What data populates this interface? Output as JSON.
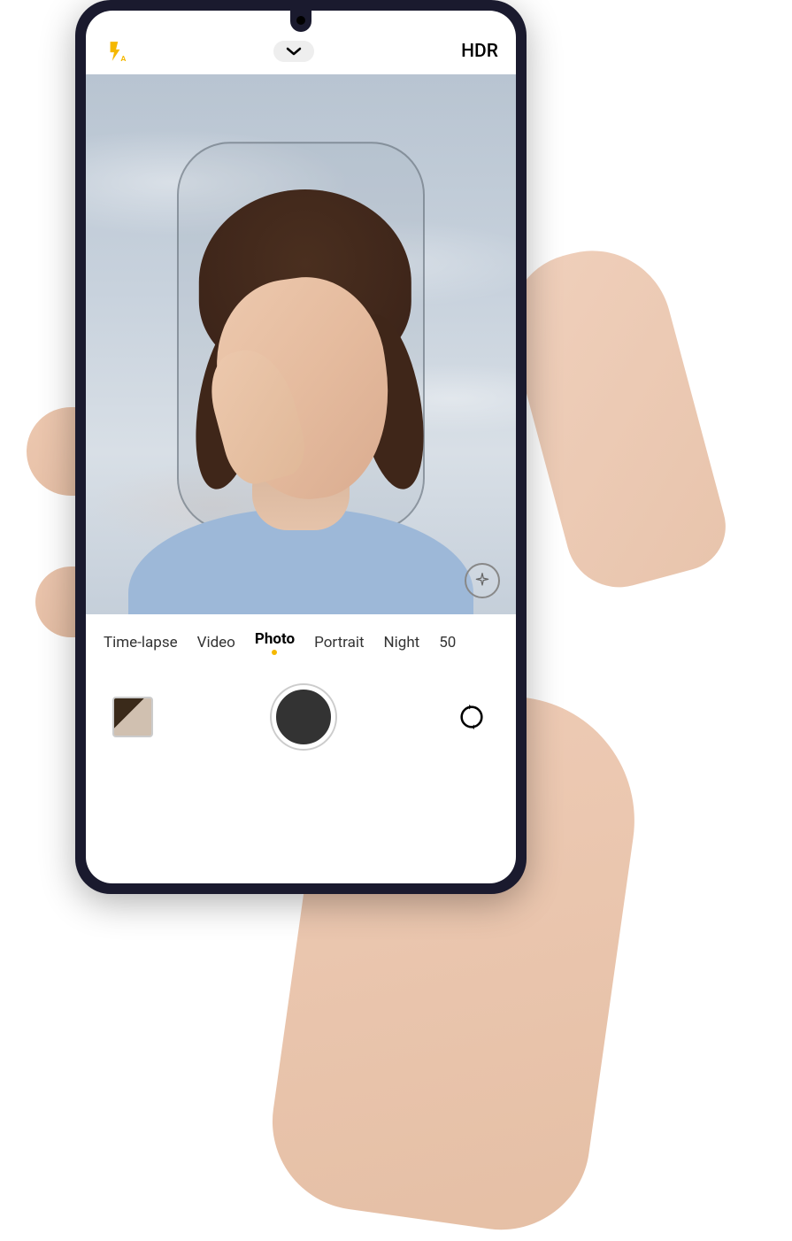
{
  "topbar": {
    "hdr_label": "HDR"
  },
  "modes": {
    "items": [
      "Time-lapse",
      "Video",
      "Photo",
      "Portrait",
      "Night",
      "50"
    ],
    "active_index": 2
  },
  "icons": {
    "flash": "flash-auto",
    "chevron": "chevron-down",
    "effects": "sparkle",
    "flip": "flip-camera"
  }
}
